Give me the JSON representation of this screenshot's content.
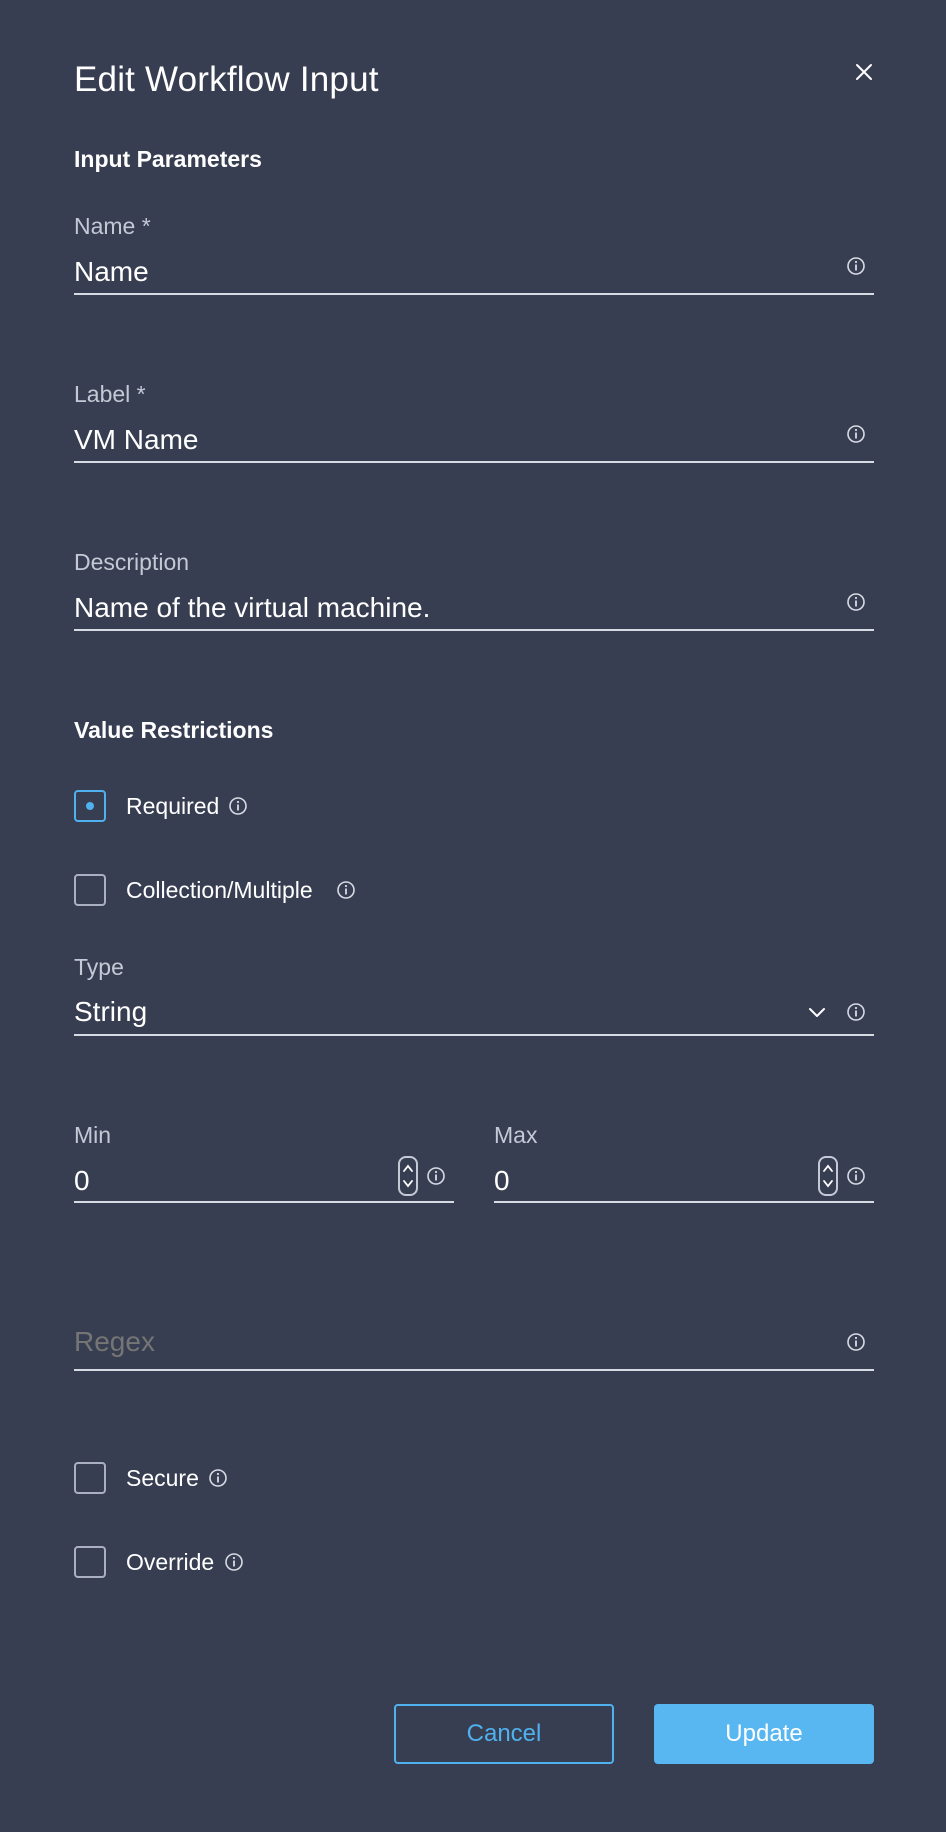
{
  "dialog": {
    "title": "Edit Workflow Input"
  },
  "input_parameters": {
    "heading": "Input Parameters",
    "name": {
      "label": "Name *",
      "value": "Name"
    },
    "label": {
      "label": "Label *",
      "value": "VM Name"
    },
    "description": {
      "label": "Description",
      "value": "Name of the virtual machine."
    }
  },
  "value_restrictions": {
    "heading": "Value Restrictions",
    "required": {
      "label": "Required",
      "checked": true
    },
    "collection": {
      "label": "Collection/Multiple",
      "checked": false
    },
    "type": {
      "label": "Type",
      "value": "String"
    },
    "min": {
      "label": "Min",
      "value": "0"
    },
    "max": {
      "label": "Max",
      "value": "0"
    },
    "regex": {
      "placeholder": "Regex",
      "value": ""
    },
    "secure": {
      "label": "Secure",
      "checked": false
    },
    "override": {
      "label": "Override",
      "checked": false
    }
  },
  "actions": {
    "cancel_label": "Cancel",
    "update_label": "Update"
  },
  "colors": {
    "background": "#383e51",
    "accent": "#4fb1ee",
    "primary_button": "#58b6f0"
  },
  "icons": {
    "close": "close-icon",
    "info": "info-icon",
    "chevron": "chevron-down-icon",
    "spinner": "number-stepper-icon"
  }
}
